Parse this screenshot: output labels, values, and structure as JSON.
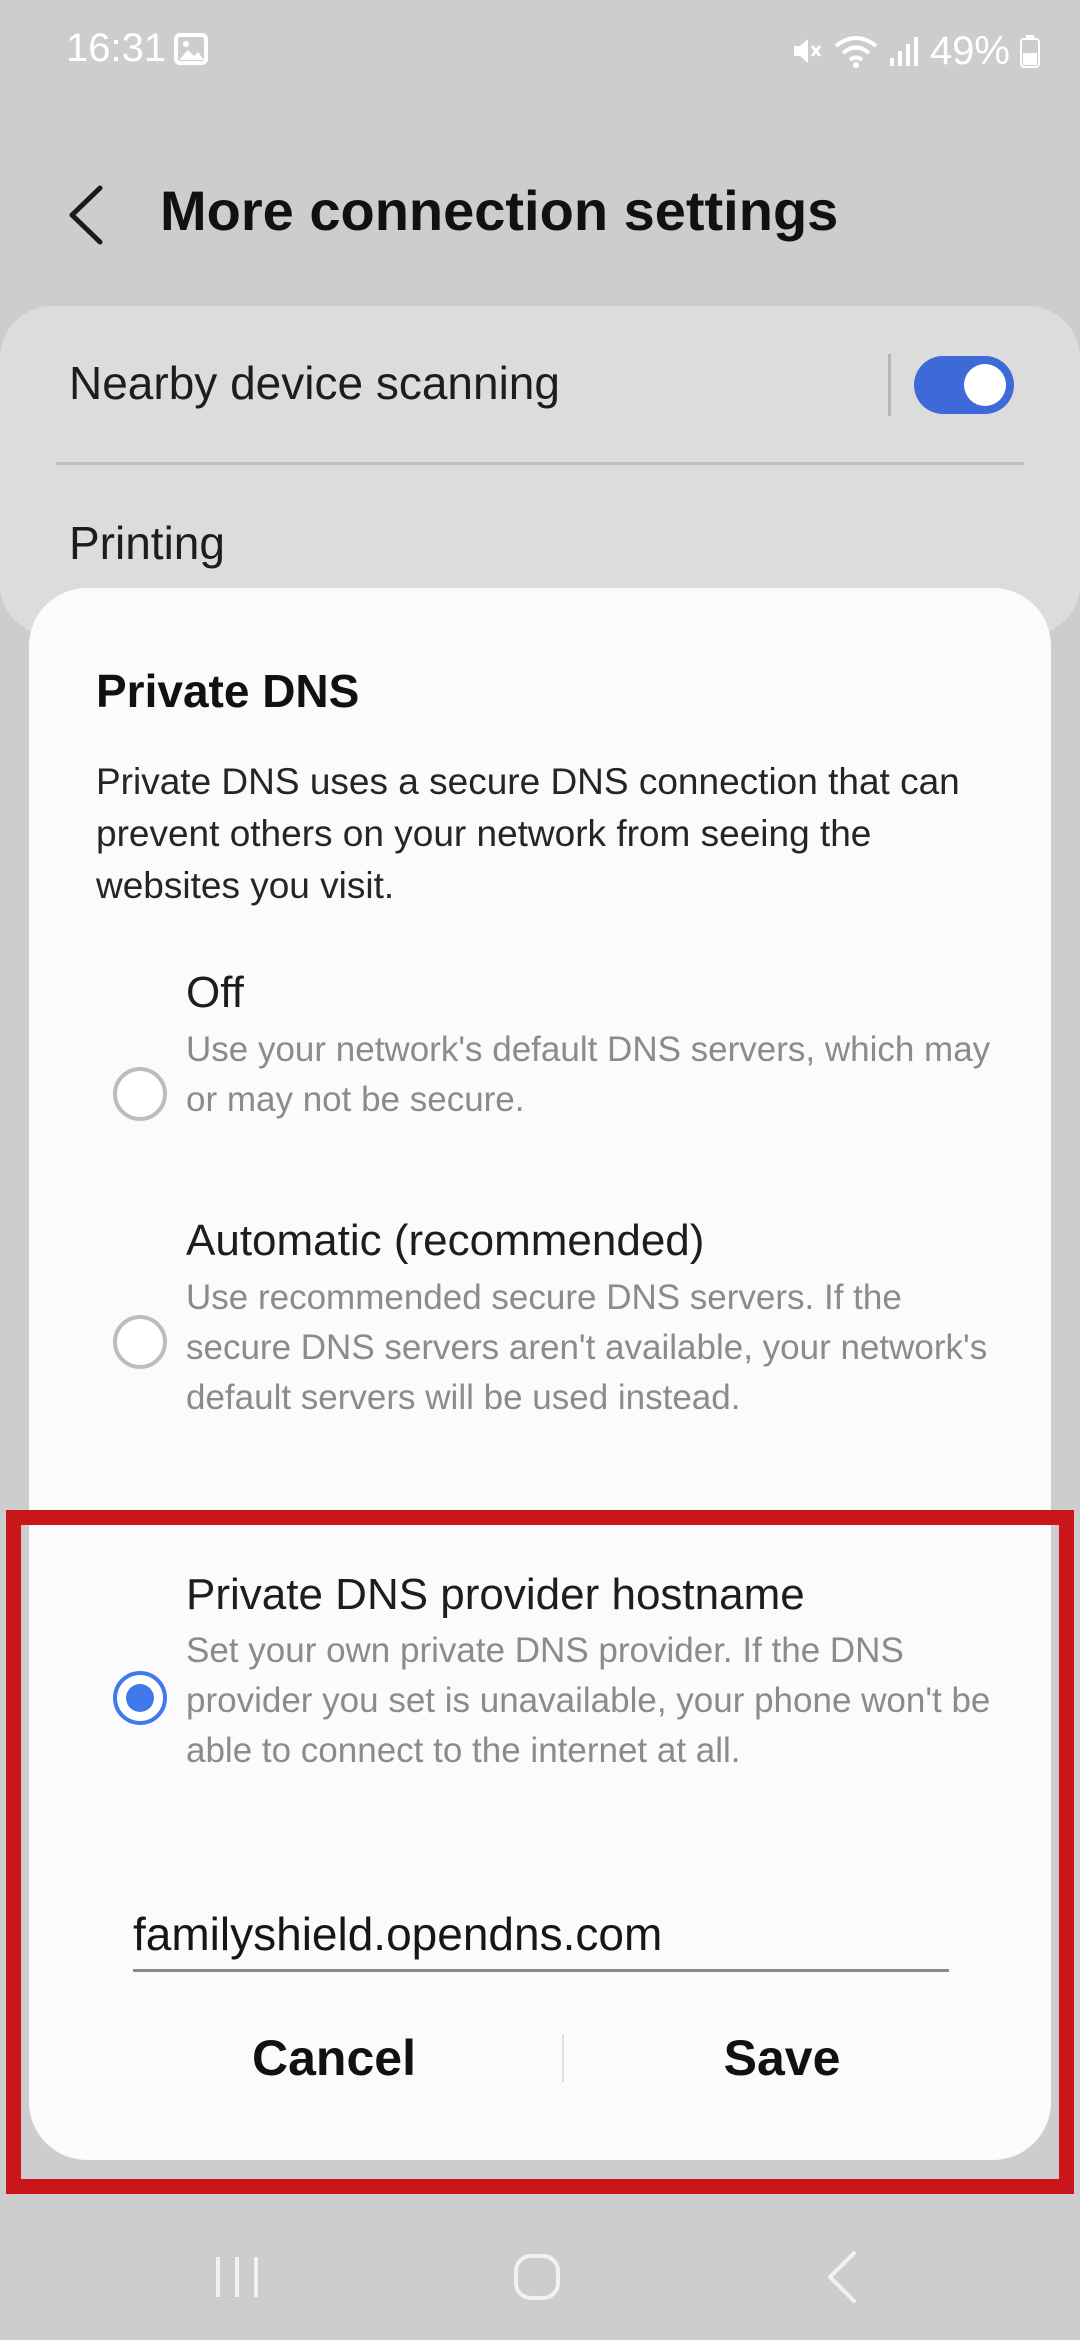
{
  "status_bar": {
    "time": "16:31",
    "battery": "49%",
    "icons": [
      "gallery-icon",
      "mute-icon",
      "wifi-icon",
      "signal-icon",
      "battery-icon"
    ]
  },
  "header": {
    "title": "More connection settings",
    "back_icon": "chevron-left-icon"
  },
  "settings": {
    "nearby_label": "Nearby device scanning",
    "nearby_enabled": true,
    "printing_label": "Printing"
  },
  "dialog": {
    "title": "Private DNS",
    "description": "Private DNS uses a secure DNS connection that can prevent others on your network from seeing the websites you visit.",
    "options": [
      {
        "title": "Off",
        "description": "Use your network's default DNS servers, which may or may not be secure.",
        "selected": false
      },
      {
        "title": "Automatic (recommended)",
        "description": "Use recommended secure DNS servers. If the secure DNS servers aren't available, your network's default servers will be used instead.",
        "selected": false
      },
      {
        "title": "Private DNS provider hostname",
        "description": "Set your own private DNS provider. If the DNS provider you set is unavailable, your phone won't be able to connect to the internet at all.",
        "selected": true
      }
    ],
    "hostname_value": "familyshield.opendns.com",
    "cancel_label": "Cancel",
    "save_label": "Save"
  },
  "colors": {
    "accent": "#3f79ea",
    "toggle_on": "#3d6ad6",
    "highlight": "#c8161b",
    "background": "#cdcdcd",
    "dialog": "#fbfbfd"
  },
  "nav_bar": {
    "icons": [
      "recents-icon",
      "home-icon",
      "back-icon"
    ]
  }
}
